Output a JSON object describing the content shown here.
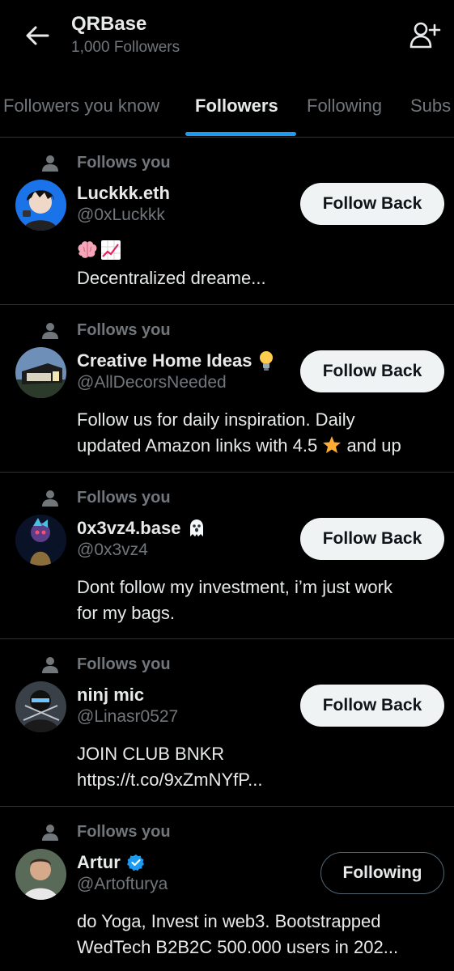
{
  "header": {
    "title": "QRBase",
    "subtitle": "1,000 Followers"
  },
  "tabs": [
    {
      "label": "Followers you know"
    },
    {
      "label": "Followers"
    },
    {
      "label": "Following"
    },
    {
      "label": "Subs"
    }
  ],
  "active_tab": "Followers",
  "colors": {
    "accent": "#1d9bf0",
    "background": "#000000",
    "muted": "#71767b",
    "text": "#e7e9ea",
    "button_bg": "#eff3f4"
  },
  "followers": [
    {
      "follows_label": "Follows you",
      "name": "Luckkk.eth",
      "handle": "@0xLuckkk",
      "bio_emojis": [
        "brain-emoji",
        "chart-increasing-emoji"
      ],
      "bio": "Decentralized dreame...",
      "button": "Follow Back"
    },
    {
      "follows_label": "Follows you",
      "name": "Creative Home Ideas",
      "name_emoji": "light-bulb-emoji",
      "handle": "@AllDecorsNeeded",
      "bio_line1": "Follow us for daily inspiration. Daily",
      "bio_line2a": "updated Amazon links with 4.5",
      "bio_emoji": "star-emoji",
      "bio_line2b": "and up",
      "button": "Follow Back"
    },
    {
      "follows_label": "Follows you",
      "name": "0x3vz4.base",
      "name_emoji": "ghost-emoji",
      "handle": "@0x3vz4",
      "bio_line1": "Dont follow my investment, i’m just work",
      "bio_line2": "for my bags.",
      "button": "Follow Back"
    },
    {
      "follows_label": "Follows you",
      "name": "ninj mic",
      "handle": "@Linasr0527",
      "bio_line1": "JOIN CLUB BNKR",
      "bio_line2": "https://t.co/9xZmNYfP...",
      "button": "Follow Back"
    },
    {
      "follows_label": "Follows you",
      "name": "Artur",
      "name_badge": "verified-badge",
      "handle": "@Artofturya",
      "bio_line1": "do Yoga, Invest in web3. Bootstrapped",
      "bio_line2": "WedTech B2B2C 500.000 users in 202...",
      "button": "Following"
    }
  ]
}
